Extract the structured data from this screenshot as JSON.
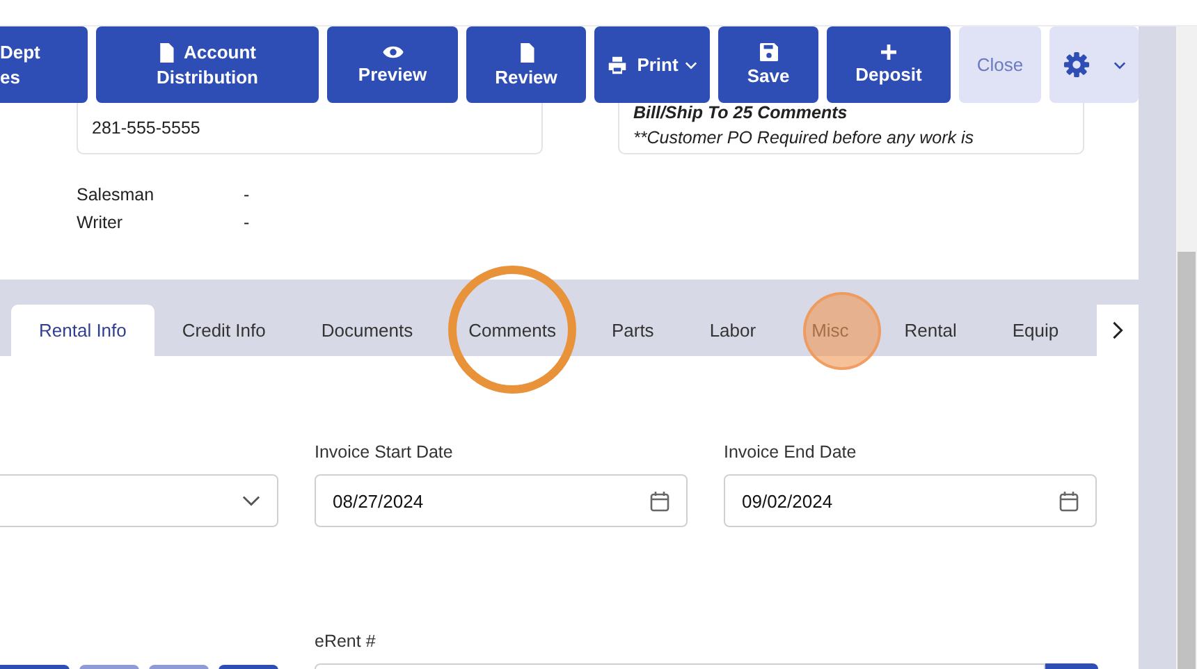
{
  "toolbar": [
    {
      "lines": [
        "Dept",
        "es"
      ],
      "kind": "primary"
    },
    {
      "lines": [
        "Account",
        "Distribution"
      ],
      "kind": "primary"
    },
    {
      "lines": [
        "Preview"
      ],
      "kind": "primary"
    },
    {
      "lines": [
        "Review"
      ],
      "kind": "primary"
    },
    {
      "lines": [
        "Print"
      ],
      "kind": "primary"
    },
    {
      "lines": [
        "Save"
      ],
      "kind": "primary"
    },
    {
      "lines": [
        "Deposit"
      ],
      "kind": "primary"
    },
    {
      "lines": [
        "Close"
      ],
      "kind": "light"
    },
    {
      "kind": "light"
    }
  ],
  "info_boxes": [
    {
      "lines": [
        "281-555-5555"
      ]
    },
    {
      "lines": [
        "Bill/Ship To 25 Comments",
        "**Customer PO Required before any work is"
      ]
    }
  ],
  "people": [
    {
      "label": "Salesman",
      "value": "-"
    },
    {
      "label": "Writer",
      "value": "-"
    }
  ],
  "tabs": [
    {
      "label": "Rental Info",
      "selected": true
    },
    {
      "label": "Credit Info",
      "selected": false
    },
    {
      "label": "Documents",
      "selected": false
    },
    {
      "label": "Comments",
      "selected": false
    },
    {
      "label": "Parts",
      "selected": false
    },
    {
      "label": "Labor",
      "selected": false
    },
    {
      "label": "Misc",
      "selected": false
    },
    {
      "label": "Rental",
      "selected": false
    },
    {
      "label": "Equip",
      "selected": false
    }
  ],
  "form": {
    "invoice_start_date": {
      "label": "Invoice Start Date",
      "value": "08/27/2024"
    },
    "invoice_end_date": {
      "label": "Invoice End Date",
      "value": "09/02/2024"
    },
    "erent": {
      "label": "eRent #"
    },
    "small_buttons": [
      {
        "kind": "primary"
      },
      {
        "kind": "soft"
      },
      {
        "kind": "soft"
      },
      {
        "kind": "primary"
      }
    ]
  }
}
